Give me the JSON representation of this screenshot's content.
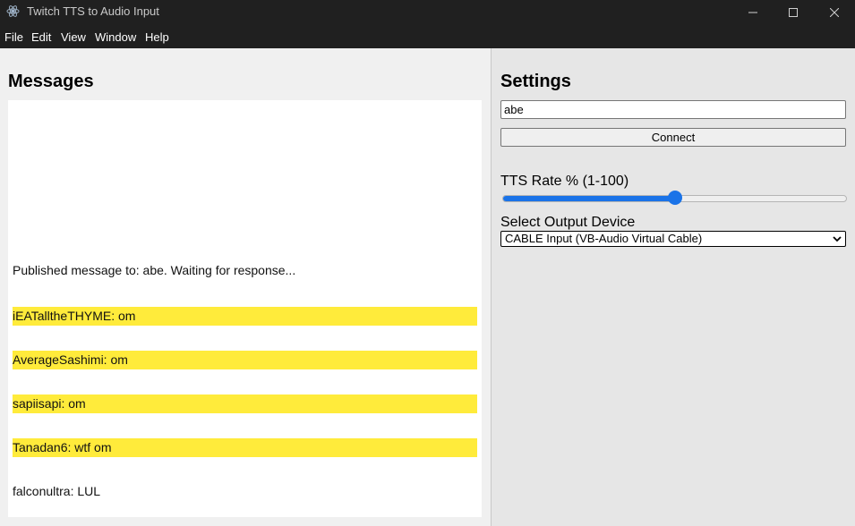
{
  "window": {
    "title": "Twitch TTS to Audio Input"
  },
  "menu": [
    "File",
    "Edit",
    "View",
    "Window",
    "Help"
  ],
  "messages_panel": {
    "heading": "Messages",
    "items": [
      {
        "text": "Published message to: abe. Waiting for response...",
        "highlighted": false
      },
      {
        "text": "iEATalltheTHYME: om",
        "highlighted": true
      },
      {
        "text": "AverageSashimi: om",
        "highlighted": true
      },
      {
        "text": "sapiisapi: om",
        "highlighted": true
      },
      {
        "text": "Tanadan6: wtf om",
        "highlighted": true
      },
      {
        "text": "falconultra: LUL",
        "highlighted": false
      }
    ],
    "highlight_color": "#ffeb3b"
  },
  "settings_panel": {
    "heading": "Settings",
    "channel_value": "abe",
    "connect_label": "Connect",
    "tts_rate_label": "TTS Rate % (1-100)",
    "tts_rate_value_fraction": 0.5,
    "output_device_label": "Select Output Device",
    "output_device_selected": "CABLE Input (VB-Audio Virtual Cable)",
    "accent_color": "#1a73e8"
  }
}
